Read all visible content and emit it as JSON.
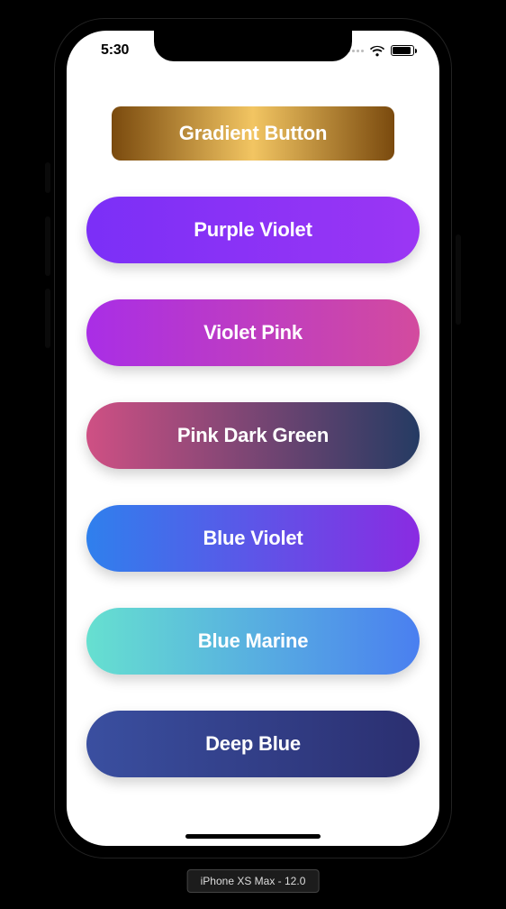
{
  "status": {
    "time": "5:30"
  },
  "buttons": [
    {
      "label": "Gradient Button",
      "shape": "rounded",
      "gradient": [
        "#7a4a0e",
        "#f2c562",
        "#7a4a0e"
      ]
    },
    {
      "label": "Purple Violet",
      "shape": "pill",
      "gradient": [
        "#7b2ff7",
        "#9b36f4"
      ]
    },
    {
      "label": "Violet Pink",
      "shape": "pill",
      "gradient": [
        "#a92ee6",
        "#d34b9e"
      ]
    },
    {
      "label": "Pink Dark Green",
      "shape": "pill",
      "gradient": [
        "#cf5084",
        "#253b63"
      ]
    },
    {
      "label": "Blue Violet",
      "shape": "pill",
      "gradient": [
        "#2f80ed",
        "#8a2be2"
      ]
    },
    {
      "label": "Blue Marine",
      "shape": "pill",
      "gradient": [
        "#66e0d0",
        "#4a7ff0"
      ]
    },
    {
      "label": "Deep Blue",
      "shape": "pill",
      "gradient": [
        "#3a4fa0",
        "#2b2f70"
      ]
    }
  ],
  "device": {
    "label": "iPhone XS Max - 12.0"
  }
}
